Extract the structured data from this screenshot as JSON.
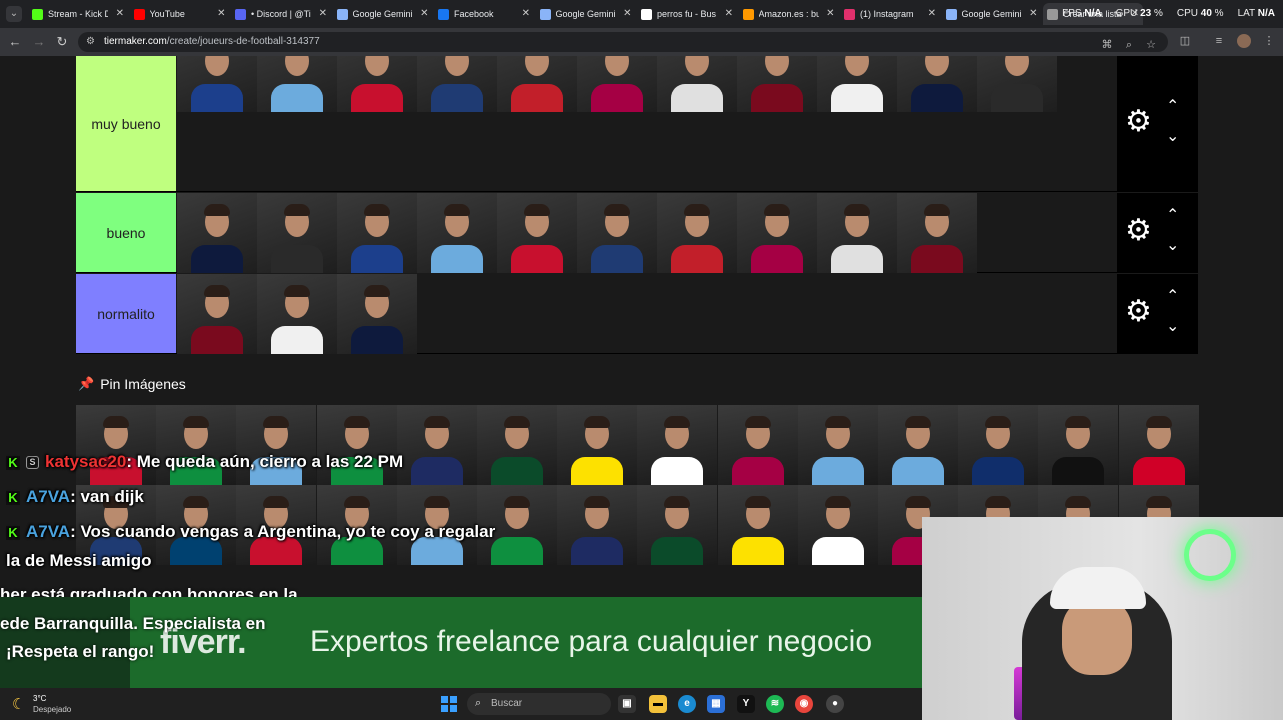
{
  "browser": {
    "tabs": [
      {
        "label": "Stream - Kick D",
        "icon": "kick-icon",
        "color": "#53fc18"
      },
      {
        "label": "YouTube",
        "icon": "youtube-icon",
        "color": "#ff0000"
      },
      {
        "label": "• Discord | @Ti",
        "icon": "discord-icon",
        "color": "#5865f2"
      },
      {
        "label": "Google Gemini",
        "icon": "gemini-icon",
        "color": "#8ab4f8"
      },
      {
        "label": "Facebook",
        "icon": "facebook-icon",
        "color": "#1877f2"
      },
      {
        "label": "Google Gemini",
        "icon": "gemini-icon",
        "color": "#8ab4f8"
      },
      {
        "label": "perros fu - Bus",
        "icon": "google-icon",
        "color": "#ffffff"
      },
      {
        "label": "Amazon.es : bu",
        "icon": "amazon-icon",
        "color": "#ff9900"
      },
      {
        "label": "(1) Instagram",
        "icon": "instagram-icon",
        "color": "#e1306c"
      },
      {
        "label": "Google Gemini",
        "icon": "gemini-icon",
        "color": "#8ab4f8"
      },
      {
        "label": "Crear una lista",
        "icon": "tiermaker-icon",
        "color": "#999999"
      }
    ],
    "stats": {
      "fps_label": "FPS",
      "fps_value": "N/A",
      "gpu_label": "GPU",
      "gpu_value": "23",
      "cpu_label": "CPU",
      "cpu_value": "40",
      "lat_label": "LAT",
      "lat_value": "N/A"
    },
    "url_domain": "tiermaker.com",
    "url_path": "/create/joueurs-de-football-314377"
  },
  "tiers": [
    {
      "label": "muy bueno",
      "color": "#bfff7f",
      "count": 11
    },
    {
      "label": "bueno",
      "color": "#7fff7f",
      "count": 10
    },
    {
      "label": "normalito",
      "color": "#7f7fff",
      "count": 3
    }
  ],
  "pin_section": {
    "title": "Pin Imágenes",
    "icon": "pin-icon"
  },
  "chat": [
    {
      "platform_icon": "kick-icon",
      "user": "katysac20",
      "message": ": Me queda aún, cierro a las 22 PM"
    },
    {
      "platform_icon": "kick-icon",
      "user": "A7VA",
      "message": ": van dijk"
    },
    {
      "platform_icon": "kick-icon",
      "user": "A7VA",
      "message": ": Vos cuando vengas a Argentina, yo te coy a regalar"
    },
    {
      "continuation": "la de Messi amigo"
    }
  ],
  "promo_lines": [
    "her está graduado con honores en la",
    "ede Barranquilla. Especialista en",
    "¡Respeta el rango!"
  ],
  "banner": {
    "logo": "fiverr.",
    "text": "Expertos freelance para cualquier negocio"
  },
  "taskbar": {
    "weather_temp": "3°C",
    "weather_desc": "Despejado",
    "search_placeholder": "Buscar"
  }
}
